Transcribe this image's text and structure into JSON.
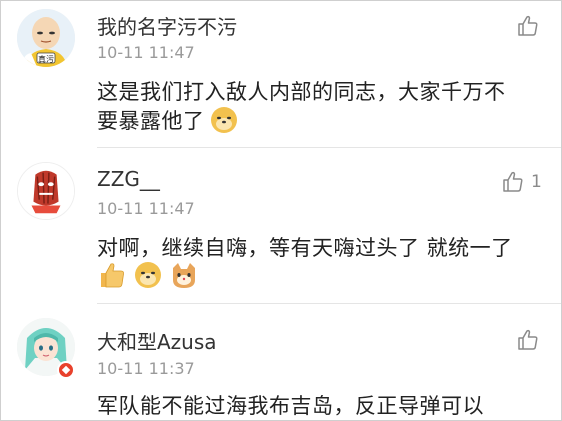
{
  "comments": [
    {
      "username": "我的名字污不污",
      "time": "10-11 11:47",
      "text_line1": "这是我们打入敌人内部的同志，大家千万不",
      "text_line2": "要暴露他了",
      "avatar_text": "真污",
      "avatar_icon": "bald-hero-avatar",
      "like_icon": "thumbs-up-icon",
      "like_count": "",
      "emojis": [
        "doge-emoji"
      ]
    },
    {
      "username": "ZZG__",
      "time": "10-11 11:47",
      "text_line1": "对啊，继续自嗨，等有天嗨过头了 就统一了",
      "avatar_icon": "red-titan-avatar",
      "like_icon": "thumbs-up-icon",
      "like_count": "1",
      "emojis": [
        "thumbs-up-emoji",
        "doge-emoji",
        "cat-emoji"
      ]
    },
    {
      "username": "大和型Azusa",
      "time": "10-11 11:37",
      "text_line1": "军队能不能过海我布吉岛，反正导弹可以",
      "avatar_icon": "green-hair-anime-avatar",
      "like_icon": "thumbs-up-icon",
      "like_count": "",
      "badge_icon": "verified-badge-icon",
      "emojis": []
    }
  ],
  "colors": {
    "name": "#333333",
    "time": "#9a9a9a",
    "text": "#222222",
    "icon_gray": "#8a8a8a",
    "badge": "#e8412c"
  }
}
